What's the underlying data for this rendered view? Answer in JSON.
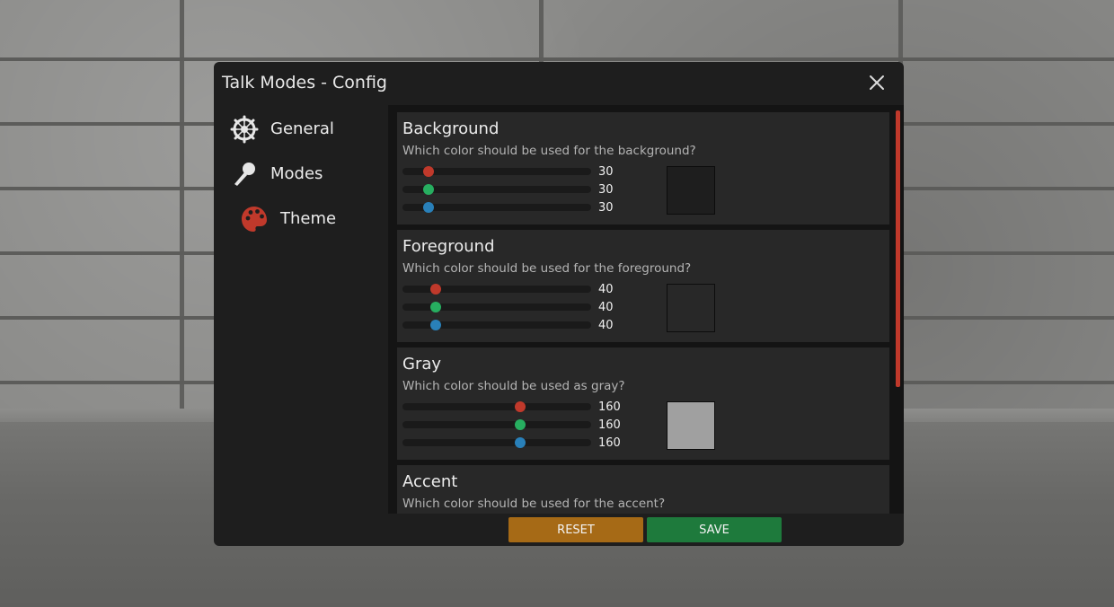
{
  "window": {
    "title": "Talk Modes - Config"
  },
  "sidebar": {
    "items": [
      {
        "label": "General",
        "icon": "gear-icon"
      },
      {
        "label": "Modes",
        "icon": "microphone-icon"
      },
      {
        "label": "Theme",
        "icon": "palette-icon"
      }
    ]
  },
  "colors": {
    "red_knob": "#c0392b",
    "green_knob": "#27ae60",
    "blue_knob": "#2980b9",
    "accent": "#c0392b",
    "reset_button": "#a66a16",
    "save_button": "#1e7a3c"
  },
  "sections": [
    {
      "title": "Background",
      "description": "Which color should be used for the background?",
      "r": "30",
      "g": "30",
      "b": "30",
      "swatch": "#1e1e1e"
    },
    {
      "title": "Foreground",
      "description": "Which color should be used for the foreground?",
      "r": "40",
      "g": "40",
      "b": "40",
      "swatch": "#282828"
    },
    {
      "title": "Gray",
      "description": "Which color should be used as gray?",
      "r": "160",
      "g": "160",
      "b": "160",
      "swatch": "#a0a0a0"
    },
    {
      "title": "Accent",
      "description": "Which color should be used for the accent?"
    }
  ],
  "footer": {
    "reset_label": "RESET",
    "save_label": "SAVE"
  }
}
